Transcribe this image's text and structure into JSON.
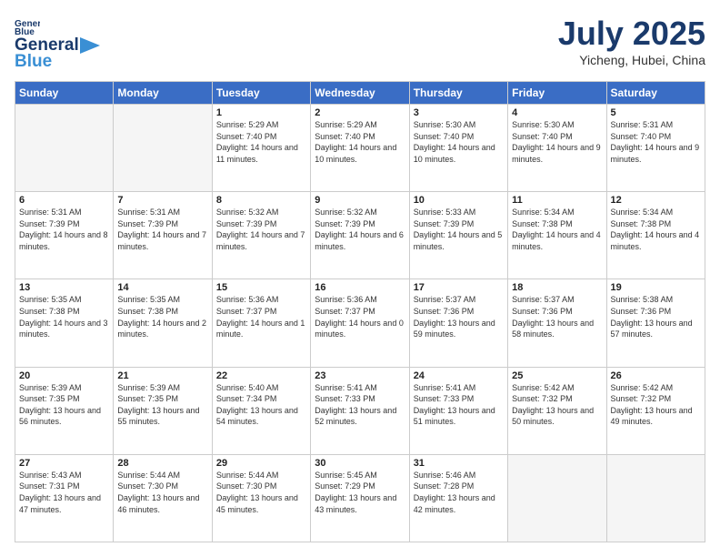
{
  "header": {
    "logo_line1": "General",
    "logo_line2": "Blue",
    "month": "July 2025",
    "location": "Yicheng, Hubei, China"
  },
  "days_of_week": [
    "Sunday",
    "Monday",
    "Tuesday",
    "Wednesday",
    "Thursday",
    "Friday",
    "Saturday"
  ],
  "weeks": [
    [
      {
        "day": "",
        "info": ""
      },
      {
        "day": "",
        "info": ""
      },
      {
        "day": "1",
        "info": "Sunrise: 5:29 AM\nSunset: 7:40 PM\nDaylight: 14 hours and 11 minutes."
      },
      {
        "day": "2",
        "info": "Sunrise: 5:29 AM\nSunset: 7:40 PM\nDaylight: 14 hours and 10 minutes."
      },
      {
        "day": "3",
        "info": "Sunrise: 5:30 AM\nSunset: 7:40 PM\nDaylight: 14 hours and 10 minutes."
      },
      {
        "day": "4",
        "info": "Sunrise: 5:30 AM\nSunset: 7:40 PM\nDaylight: 14 hours and 9 minutes."
      },
      {
        "day": "5",
        "info": "Sunrise: 5:31 AM\nSunset: 7:40 PM\nDaylight: 14 hours and 9 minutes."
      }
    ],
    [
      {
        "day": "6",
        "info": "Sunrise: 5:31 AM\nSunset: 7:39 PM\nDaylight: 14 hours and 8 minutes."
      },
      {
        "day": "7",
        "info": "Sunrise: 5:31 AM\nSunset: 7:39 PM\nDaylight: 14 hours and 7 minutes."
      },
      {
        "day": "8",
        "info": "Sunrise: 5:32 AM\nSunset: 7:39 PM\nDaylight: 14 hours and 7 minutes."
      },
      {
        "day": "9",
        "info": "Sunrise: 5:32 AM\nSunset: 7:39 PM\nDaylight: 14 hours and 6 minutes."
      },
      {
        "day": "10",
        "info": "Sunrise: 5:33 AM\nSunset: 7:39 PM\nDaylight: 14 hours and 5 minutes."
      },
      {
        "day": "11",
        "info": "Sunrise: 5:34 AM\nSunset: 7:38 PM\nDaylight: 14 hours and 4 minutes."
      },
      {
        "day": "12",
        "info": "Sunrise: 5:34 AM\nSunset: 7:38 PM\nDaylight: 14 hours and 4 minutes."
      }
    ],
    [
      {
        "day": "13",
        "info": "Sunrise: 5:35 AM\nSunset: 7:38 PM\nDaylight: 14 hours and 3 minutes."
      },
      {
        "day": "14",
        "info": "Sunrise: 5:35 AM\nSunset: 7:38 PM\nDaylight: 14 hours and 2 minutes."
      },
      {
        "day": "15",
        "info": "Sunrise: 5:36 AM\nSunset: 7:37 PM\nDaylight: 14 hours and 1 minute."
      },
      {
        "day": "16",
        "info": "Sunrise: 5:36 AM\nSunset: 7:37 PM\nDaylight: 14 hours and 0 minutes."
      },
      {
        "day": "17",
        "info": "Sunrise: 5:37 AM\nSunset: 7:36 PM\nDaylight: 13 hours and 59 minutes."
      },
      {
        "day": "18",
        "info": "Sunrise: 5:37 AM\nSunset: 7:36 PM\nDaylight: 13 hours and 58 minutes."
      },
      {
        "day": "19",
        "info": "Sunrise: 5:38 AM\nSunset: 7:36 PM\nDaylight: 13 hours and 57 minutes."
      }
    ],
    [
      {
        "day": "20",
        "info": "Sunrise: 5:39 AM\nSunset: 7:35 PM\nDaylight: 13 hours and 56 minutes."
      },
      {
        "day": "21",
        "info": "Sunrise: 5:39 AM\nSunset: 7:35 PM\nDaylight: 13 hours and 55 minutes."
      },
      {
        "day": "22",
        "info": "Sunrise: 5:40 AM\nSunset: 7:34 PM\nDaylight: 13 hours and 54 minutes."
      },
      {
        "day": "23",
        "info": "Sunrise: 5:41 AM\nSunset: 7:33 PM\nDaylight: 13 hours and 52 minutes."
      },
      {
        "day": "24",
        "info": "Sunrise: 5:41 AM\nSunset: 7:33 PM\nDaylight: 13 hours and 51 minutes."
      },
      {
        "day": "25",
        "info": "Sunrise: 5:42 AM\nSunset: 7:32 PM\nDaylight: 13 hours and 50 minutes."
      },
      {
        "day": "26",
        "info": "Sunrise: 5:42 AM\nSunset: 7:32 PM\nDaylight: 13 hours and 49 minutes."
      }
    ],
    [
      {
        "day": "27",
        "info": "Sunrise: 5:43 AM\nSunset: 7:31 PM\nDaylight: 13 hours and 47 minutes."
      },
      {
        "day": "28",
        "info": "Sunrise: 5:44 AM\nSunset: 7:30 PM\nDaylight: 13 hours and 46 minutes."
      },
      {
        "day": "29",
        "info": "Sunrise: 5:44 AM\nSunset: 7:30 PM\nDaylight: 13 hours and 45 minutes."
      },
      {
        "day": "30",
        "info": "Sunrise: 5:45 AM\nSunset: 7:29 PM\nDaylight: 13 hours and 43 minutes."
      },
      {
        "day": "31",
        "info": "Sunrise: 5:46 AM\nSunset: 7:28 PM\nDaylight: 13 hours and 42 minutes."
      },
      {
        "day": "",
        "info": ""
      },
      {
        "day": "",
        "info": ""
      }
    ]
  ]
}
